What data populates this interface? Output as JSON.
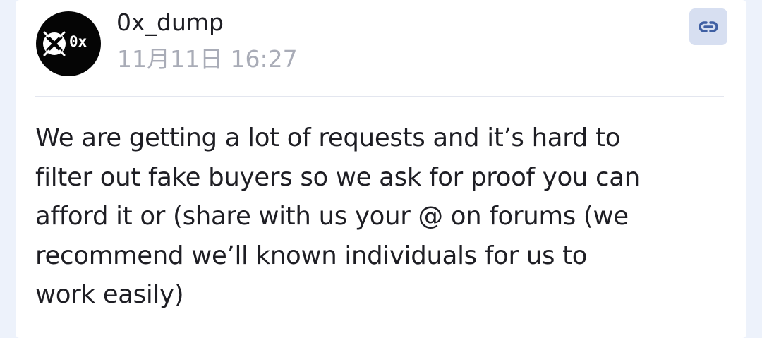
{
  "post": {
    "author": {
      "name": "0x_dump",
      "avatar_text": "0x"
    },
    "timestamp": "11月11日 16:27",
    "link_icon": "link-icon",
    "message_lines": [
      "We are getting a lot of requests and it’s hard to",
      "filter out fake buyers so we ask for proof you can",
      "afford it or (share with us your @ on forums (we",
      "recommend we’ll known individuals for us to",
      "work easily)"
    ]
  },
  "colors": {
    "page_background": "#edf2fb",
    "card_background": "#ffffff",
    "text_primary": "#1e1e24",
    "text_muted": "#a9acb7",
    "link_button_background": "#d7dff1",
    "link_icon": "#3f5fa3",
    "avatar_background": "#050505"
  }
}
